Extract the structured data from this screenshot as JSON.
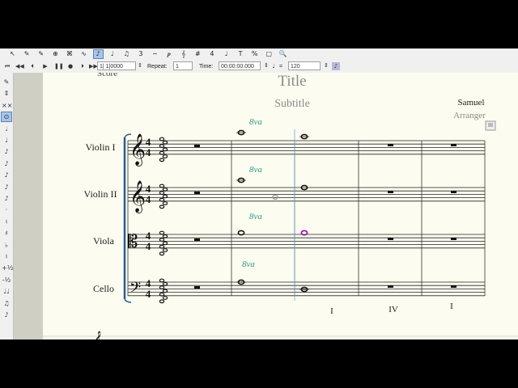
{
  "toolbar": {
    "icons": [
      "arrow-icon",
      "marker-icon",
      "speaker-icon",
      "lyric-icon",
      "chord-icon",
      "slur-icon",
      "note-icon",
      "rest-icon",
      "beam-icon",
      "tuplet-icon",
      "ornament-icon",
      "dynamics-icon",
      "clef-icon",
      "key-icon",
      "time-icon",
      "tempo-icon",
      "text-icon",
      "percent-icon",
      "page-icon",
      "zoom-icon"
    ],
    "glyphs": [
      "↖",
      "✎",
      "✎",
      "⊕",
      "⌘",
      "∿",
      "♪",
      "♩",
      "♫",
      "3",
      "~",
      "𝆏",
      "𝄞",
      "#",
      "4",
      "♩",
      "T",
      "%",
      "▢",
      "🔍"
    ]
  },
  "transport": {
    "position_value": "1| 1|0000",
    "repeat_label": "Repeat:",
    "repeat_value": "1",
    "time_label": "Time:",
    "time_value": "00:00:00.000",
    "tempo_value": "120"
  },
  "palette": {
    "glyphs": [
      "✎",
      "⇕",
      "××",
      "⊙",
      "𝅗𝅥",
      "♩",
      "♪",
      "♪",
      "♪",
      "♪",
      "♪",
      "·",
      "♮",
      "♯",
      "♭",
      "♮",
      "+½",
      "-½",
      "♩♩",
      "♫",
      "♪"
    ]
  },
  "score": {
    "title": "Title",
    "subtitle": "Subtitle",
    "composer": "Samuel",
    "arranger": "Arranger",
    "header_fragment": "Score",
    "time_signature_num": "4",
    "time_signature_den": "4",
    "instruments": [
      "Violin I",
      "Violin II",
      "Viola",
      "Cello"
    ],
    "ottava_marks": [
      "8va",
      "8va",
      "8va",
      "8va"
    ],
    "harmony": [
      "I",
      "IV",
      "I"
    ],
    "colors": {
      "page": "#fcfcf0",
      "ottava": "#2e9b8a",
      "selected": "#9a1aa3",
      "guide": "#6da7d8"
    }
  }
}
